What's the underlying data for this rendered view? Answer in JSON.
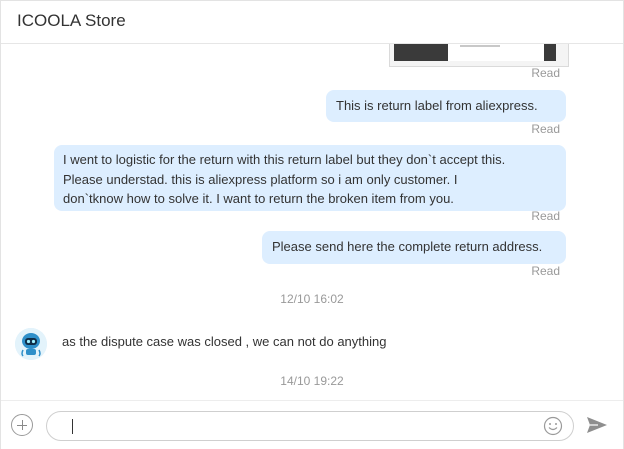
{
  "header": {
    "title": "ICOOLA Store"
  },
  "messages": {
    "read_label": "Read",
    "outgoing_1": "This is return label from aliexpress.",
    "outgoing_2_line1": "I went to logistic for the return with this return label but they don`t accept this.",
    "outgoing_2_line2": "Please understad. this is aliexpress platform so i am only customer. I",
    "outgoing_2_line3": "don`tknow how to solve it. I want to return the broken item from you.",
    "outgoing_3": "Please send here the complete return address.",
    "timestamp_1": "12/10 16:02",
    "incoming_1": "as the dispute case was closed , we can not do anything",
    "timestamp_2": "14/10 19:22"
  },
  "composer": {
    "value": ""
  },
  "colors": {
    "outgoing_bubble": "#ddeeff",
    "muted_text": "#999999",
    "border": "#e6e6e6"
  },
  "icons": [
    "plus-icon",
    "smiley-icon",
    "send-icon",
    "store-avatar"
  ]
}
